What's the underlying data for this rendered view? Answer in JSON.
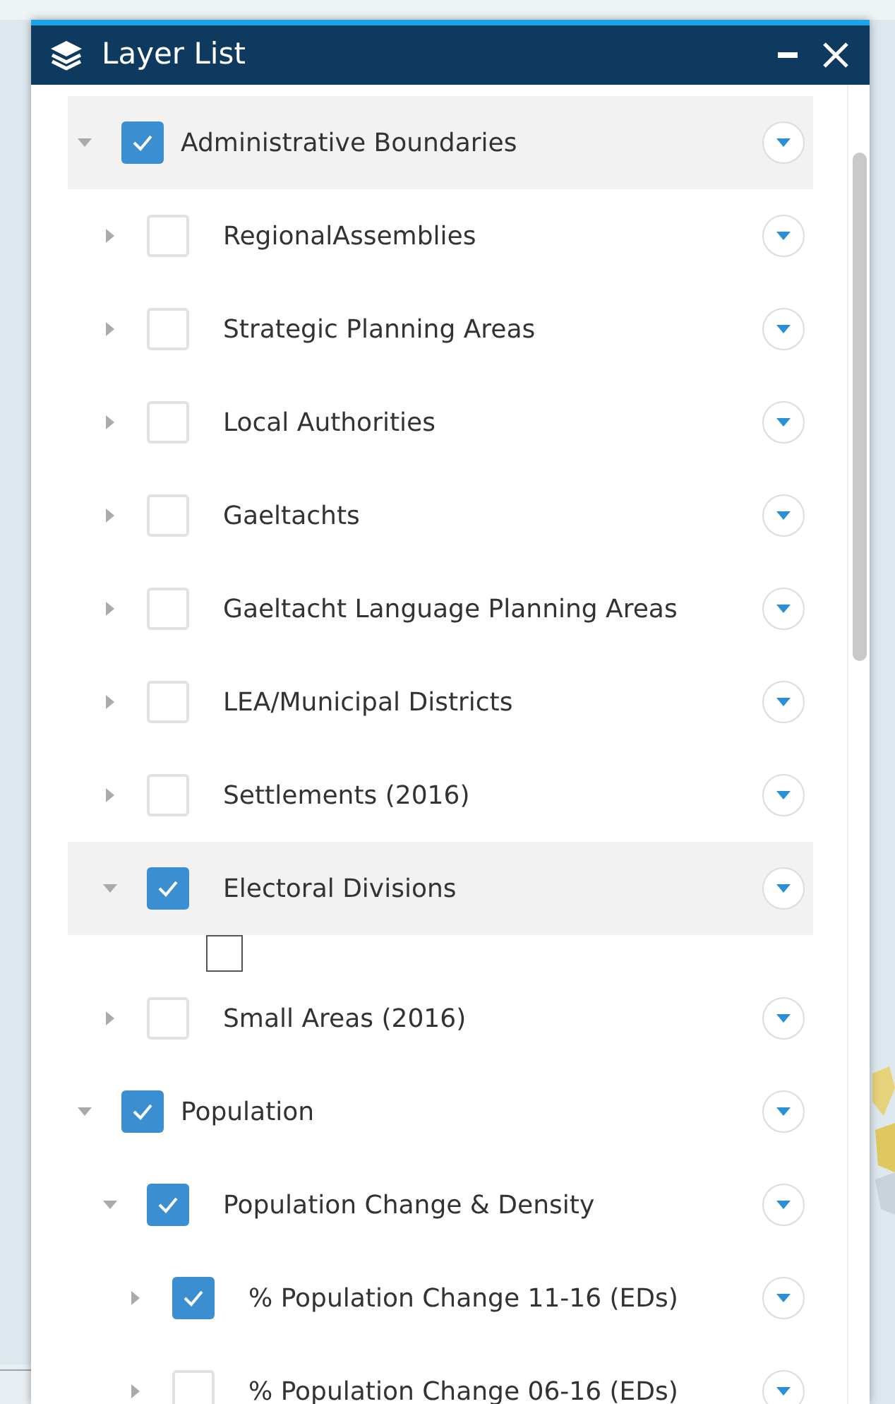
{
  "panel": {
    "title": "Layer List"
  },
  "layers": [
    {
      "kind": "layer",
      "label": "Administrative Boundaries",
      "checked": true,
      "expanded": true,
      "selected": true,
      "children": [
        {
          "kind": "layer",
          "label": "RegionalAssemblies",
          "checked": false,
          "expanded": false,
          "selected": false
        },
        {
          "kind": "layer",
          "label": "Strategic Planning Areas",
          "checked": false,
          "expanded": false,
          "selected": false
        },
        {
          "kind": "layer",
          "label": "Local Authorities",
          "checked": false,
          "expanded": false,
          "selected": false
        },
        {
          "kind": "layer",
          "label": "Gaeltachts",
          "checked": false,
          "expanded": false,
          "selected": false
        },
        {
          "kind": "layer",
          "label": "Gaeltacht Language Planning Areas",
          "checked": false,
          "expanded": false,
          "selected": false
        },
        {
          "kind": "layer",
          "label": "LEA/Municipal Districts",
          "checked": false,
          "expanded": false,
          "selected": false
        },
        {
          "kind": "layer",
          "label": "Settlements (2016)",
          "checked": false,
          "expanded": false,
          "selected": false
        },
        {
          "kind": "layer",
          "label": "Electoral Divisions",
          "checked": true,
          "expanded": true,
          "selected": true,
          "children": [
            {
              "kind": "legend",
              "checked": false
            }
          ]
        },
        {
          "kind": "layer",
          "label": "Small Areas (2016)",
          "checked": false,
          "expanded": false,
          "selected": false
        }
      ]
    },
    {
      "kind": "layer",
      "label": "Population",
      "checked": true,
      "expanded": true,
      "selected": false,
      "children": [
        {
          "kind": "layer",
          "label": "Population Change & Density",
          "checked": true,
          "expanded": true,
          "selected": false,
          "children": [
            {
              "kind": "layer",
              "label": "% Population Change 11-16 (EDs)",
              "checked": true,
              "expanded": false,
              "selected": false
            },
            {
              "kind": "layer",
              "label": "% Population Change 06-16 (EDs)",
              "checked": false,
              "expanded": false,
              "selected": false
            }
          ]
        }
      ]
    }
  ]
}
